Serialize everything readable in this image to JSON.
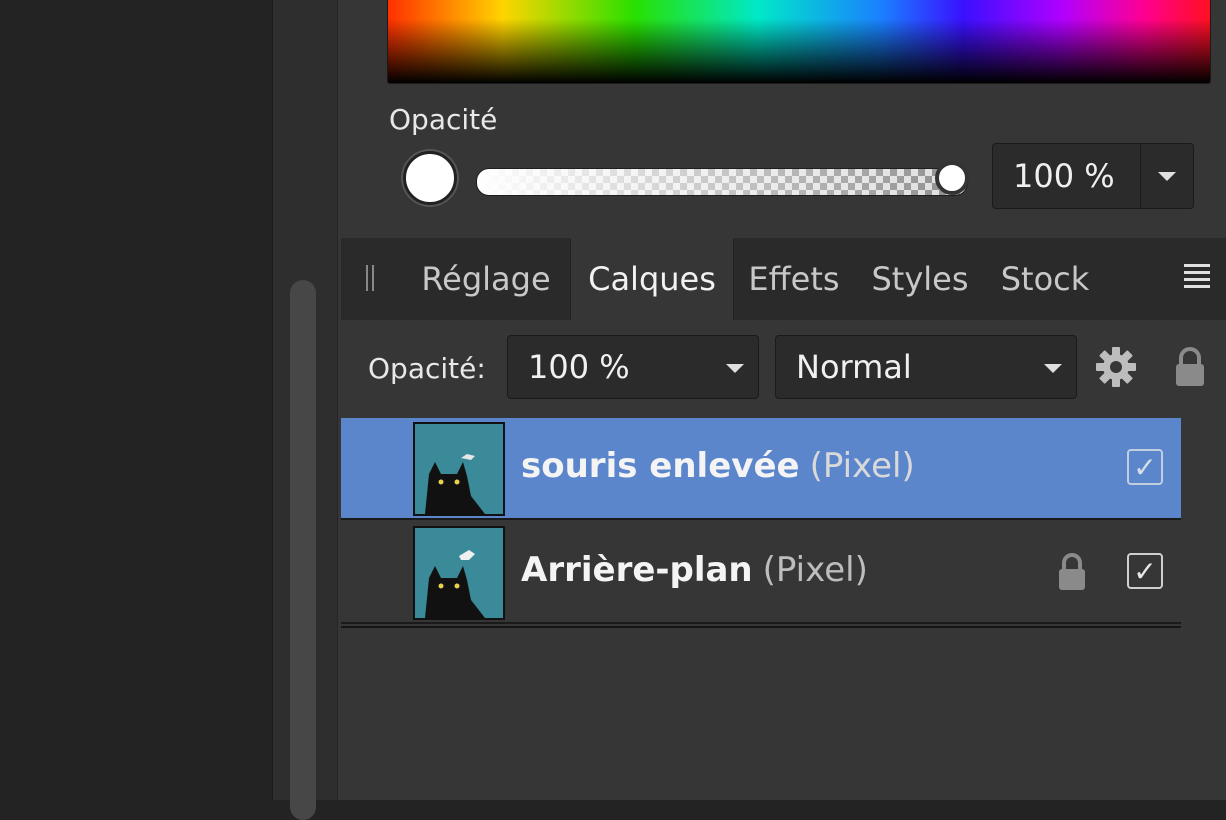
{
  "color_panel": {
    "opacity_label": "Opacité",
    "opacity_value": "100 %",
    "opacity_fraction": 1.0
  },
  "tabs": [
    {
      "label": "Réglage",
      "active": false
    },
    {
      "label": "Calques",
      "active": true
    },
    {
      "label": "Effets",
      "active": false
    },
    {
      "label": "Styles",
      "active": false
    },
    {
      "label": "Stock",
      "active": false
    }
  ],
  "layer_toolbar": {
    "opacity_label": "Opacité:",
    "opacity_value": "100 %",
    "blend_mode": "Normal"
  },
  "layers": [
    {
      "name": "souris enlevée",
      "type": "(Pixel)",
      "selected": true,
      "locked": false,
      "visible": true
    },
    {
      "name": "Arrière-plan",
      "type": "(Pixel)",
      "selected": false,
      "locked": true,
      "visible": true
    }
  ],
  "colors": {
    "selection": "#5b86cc",
    "panel": "#363636",
    "tab_bar": "#2a2a2a"
  }
}
